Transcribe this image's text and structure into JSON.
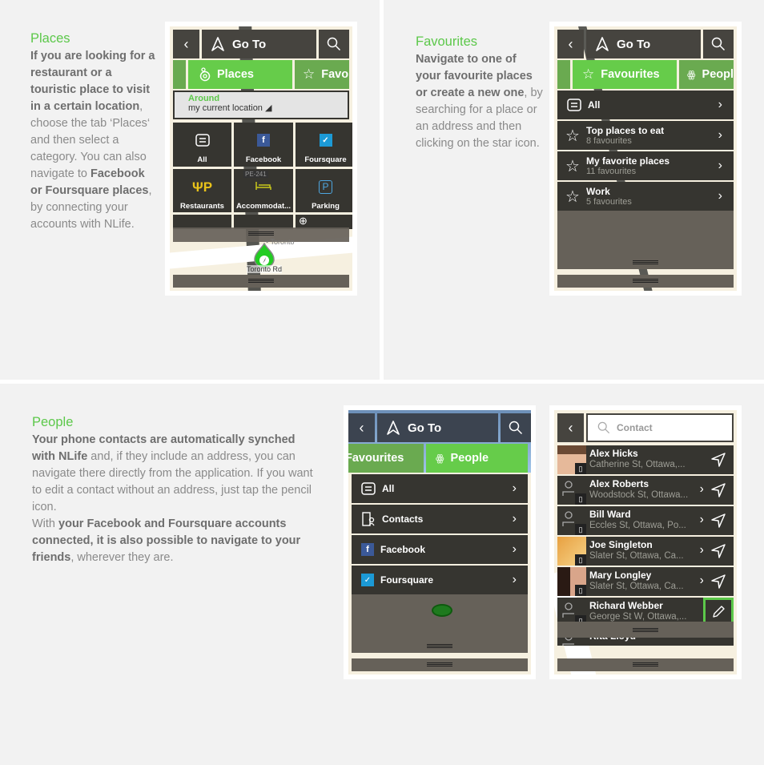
{
  "places": {
    "title": "Places",
    "desc": {
      "b1": "If you are looking for a restaurant or a touristic place to visit in a certain location",
      "t1": ", choose the tab ‘Places‘ and then select a category. You can also navigate to ",
      "b2": "Facebook or Foursquare places",
      "t2": ", by connecting your accounts with NLife."
    },
    "phone": {
      "back": "‹",
      "goto": "Go To",
      "tabs": [
        "Places",
        "Favou"
      ],
      "around_label": "Around",
      "around_value": "my current location ◢",
      "categories": [
        "All",
        "Facebook",
        "Foursquare",
        "Restaurants",
        "Accommodat...",
        "Parking"
      ],
      "map_sign": "PE-241",
      "map_city": "• Toronto",
      "map_road": "Toronto Rd"
    }
  },
  "favourites": {
    "title": "Favourites",
    "desc": {
      "b1": "Navigate to one of your favourite places or create a new one",
      "t1": ", by searching for a place or an address and then clicking on the star icon."
    },
    "phone": {
      "back": "‹",
      "goto": "Go To",
      "tabs": [
        "Favourites",
        "People"
      ],
      "all_label": "All",
      "lists": [
        {
          "name": "Top places to eat",
          "count": "8 favourites"
        },
        {
          "name": "My favorite places",
          "count": "11 favourites"
        },
        {
          "name": "Work",
          "count": "5 favourites"
        }
      ]
    }
  },
  "people": {
    "title": "People",
    "desc": {
      "b1": "Your phone contacts are automatically synched with NLife",
      "t1": " and, if they include an address, you can navigate there directly from the application. If you want to edit a contact without an address, just tap the pencil icon.",
      "t2": "With ",
      "b2": "your Facebook and Foursquare accounts connected, it is also possible to navigate to your friends",
      "t3": ", wherever they are."
    },
    "phone1": {
      "back": "‹",
      "goto": "Go To",
      "tabs": [
        "Favourites",
        "People"
      ],
      "items": [
        "All",
        "Contacts",
        "Facebook",
        "Foursquare"
      ]
    },
    "phone2": {
      "back": "‹",
      "search_placeholder": "Contact",
      "contacts": [
        {
          "name": "Alex Hicks",
          "address": "Catherine St, Ottawa,...",
          "action": "navigate"
        },
        {
          "name": "Alex Roberts",
          "address": "Woodstock St, Ottawa...",
          "action": "navigate"
        },
        {
          "name": "Bill Ward",
          "address": "Eccles St, Ottawa, Po...",
          "action": "navigate"
        },
        {
          "name": "Joe Singleton",
          "address": "Slater St, Ottawa, Ca...",
          "action": "navigate"
        },
        {
          "name": "Mary Longley",
          "address": "Slater St, Ottawa, Ca...",
          "action": "navigate"
        },
        {
          "name": "Richard Webber",
          "address": "George St W, Ottawa,...",
          "action": "edit"
        },
        {
          "name": "Rita Lloyd",
          "address": "",
          "action": ""
        }
      ]
    }
  },
  "colors": {
    "accent_green": "#66cc4a",
    "tab_inactive": "#6aaa50",
    "dark_bar": "#46443f",
    "list_bg": "#363530",
    "drawer_bg": "#666159",
    "map_bg": "#f6f0e0",
    "facebook": "#3b5998",
    "foursquare": "#1c9ad6",
    "highlight": "#5cc84a"
  }
}
